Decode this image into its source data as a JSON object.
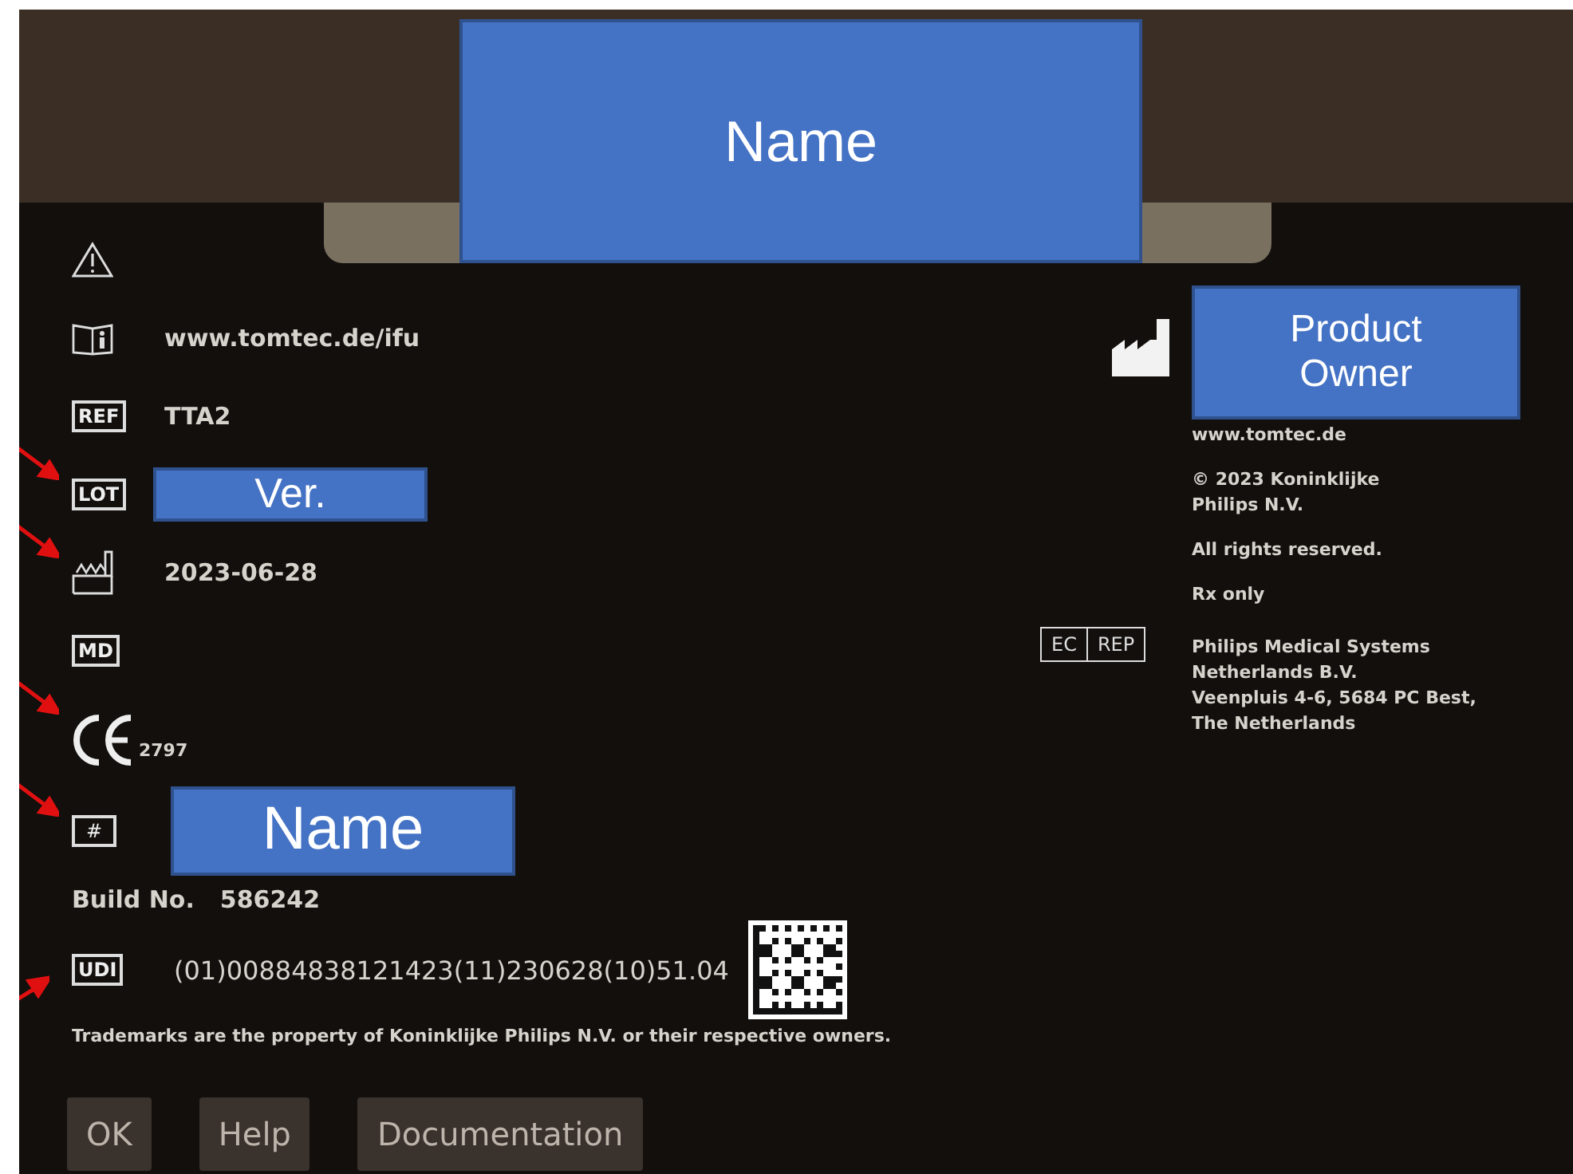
{
  "header": {
    "annotation": "Name"
  },
  "symbols": [
    {
      "kind": "warning",
      "marked": false
    },
    {
      "kind": "ifu",
      "text": "www.tomtec.de/ifu",
      "marked": false
    },
    {
      "kind": "box",
      "label": "REF",
      "text": "TTA2",
      "marked": false
    },
    {
      "kind": "box",
      "label": "LOT",
      "annotation": "Ver.",
      "marked": true
    },
    {
      "kind": "date",
      "text": "2023-06-28",
      "marked": true
    },
    {
      "kind": "box",
      "label": "MD",
      "marked": false
    },
    {
      "kind": "ce",
      "text": "2797",
      "marked": true
    },
    {
      "kind": "box",
      "label": "#",
      "annotation": "Name",
      "marked": true
    }
  ],
  "build": {
    "label": "Build No.",
    "value": "586242"
  },
  "udi": {
    "label": "UDI",
    "value": "(01)00884838121423(11)230628(10)51.04",
    "marked": true
  },
  "trademark": "Trademarks are the property of Koninklijke Philips N.V. or their respective owners.",
  "manufacturer": {
    "annotation": "Product Owner",
    "lines": [
      "www.tomtec.de",
      "© 2023 Koninklijke Philips N.V.",
      "All rights reserved.",
      "Rx only"
    ]
  },
  "ec_rep": {
    "labels": [
      "EC",
      "REP"
    ],
    "address": [
      "Philips Medical Systems",
      "Netherlands B.V.",
      "Veenpluis 4-6, 5684 PC Best,",
      "The Netherlands"
    ]
  },
  "buttons": [
    "OK",
    "Help",
    "Documentation"
  ]
}
